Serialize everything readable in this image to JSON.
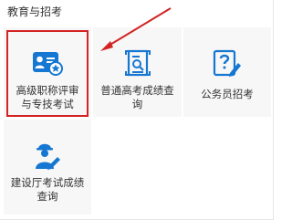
{
  "section": {
    "title": "教育与招考"
  },
  "tiles": [
    {
      "label": "高级职称评审与专技考试",
      "icon": "certificate-id-icon"
    },
    {
      "label": "普通高考成绩查询",
      "icon": "document-search-icon"
    },
    {
      "label": "公务员招考",
      "icon": "question-pencil-icon"
    },
    {
      "label": "建设厅考试成绩查询",
      "icon": "worker-pencil-icon"
    }
  ],
  "colors": {
    "accent": "#1677d2",
    "highlight": "#d32424",
    "tile_bg": "#f7f7f7"
  }
}
